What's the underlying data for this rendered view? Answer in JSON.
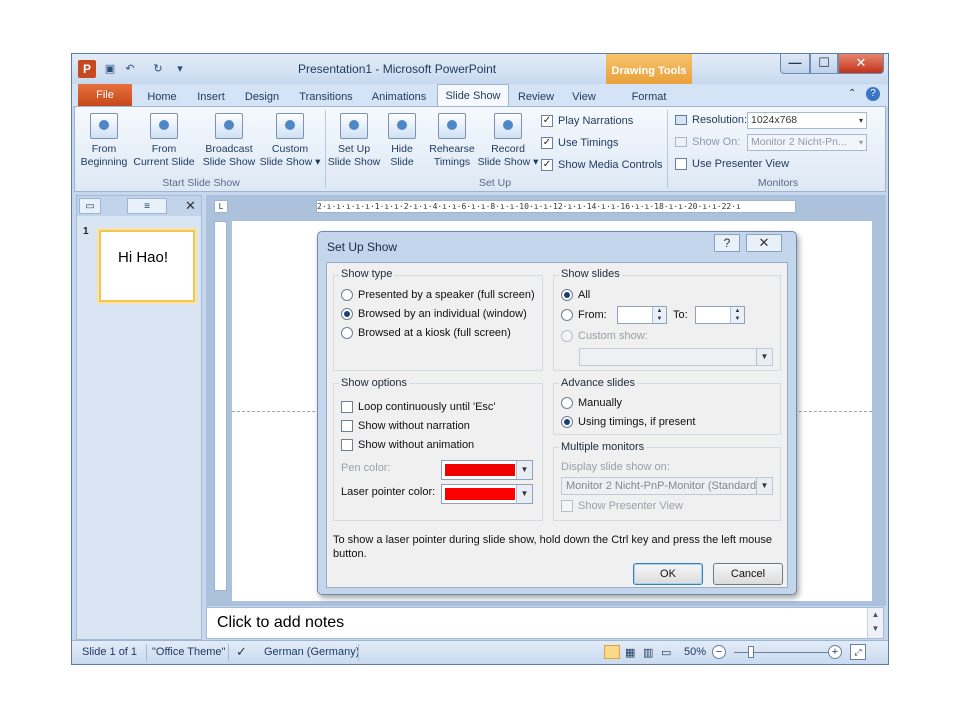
{
  "titlebar": {
    "title": "Presentation1 - Microsoft PowerPoint",
    "contextual_tab": "Drawing Tools",
    "app_icon": "P",
    "qat": [
      "save-icon",
      "undo-icon",
      "redo-icon",
      "customize-icon"
    ],
    "controls": {
      "minimize": "—",
      "maximize": "☐",
      "close": "✕"
    }
  },
  "tabs": [
    "File",
    "Home",
    "Insert",
    "Design",
    "Transitions",
    "Animations",
    "Slide Show",
    "Review",
    "View",
    "Format"
  ],
  "active_tab": "Slide Show",
  "ribbon": {
    "start_group": {
      "label": "Start Slide Show",
      "buttons": [
        {
          "line1": "From",
          "line2": "Beginning"
        },
        {
          "line1": "From",
          "line2": "Current Slide"
        },
        {
          "line1": "Broadcast",
          "line2": "Slide Show"
        },
        {
          "line1": "Custom",
          "line2": "Slide Show ▾"
        }
      ]
    },
    "setup_group": {
      "label": "Set Up",
      "buttons": [
        {
          "line1": "Set Up",
          "line2": "Slide Show"
        },
        {
          "line1": "Hide",
          "line2": "Slide"
        },
        {
          "line1": "Rehearse",
          "line2": "Timings"
        },
        {
          "line1": "Record",
          "line2": "Slide Show ▾"
        }
      ],
      "checks": [
        {
          "label": "Play Narrations",
          "checked": true
        },
        {
          "label": "Use Timings",
          "checked": true
        },
        {
          "label": "Show Media Controls",
          "checked": true
        }
      ]
    },
    "monitors_group": {
      "label": "Monitors",
      "resolution_label": "Resolution:",
      "resolution_value": "1024x768",
      "show_on_label": "Show On:",
      "show_on_value": "Monitor 2 Nicht-Pn...",
      "presenter_view_label": "Use Presenter View",
      "presenter_view_checked": false
    }
  },
  "slides_pane": {
    "slide_number": "1",
    "thumbnail_text": "Hi Hao!"
  },
  "ruler": {
    "horizontal": "2·ı·ı·ı·ı·ı·1·ı·ı·2·ı·ı·4·ı·ı·6·ı·ı·8·ı·ı·10·ı·ı·12·ı·ı·14·ı·ı·16·ı·ı·18·ı·ı·20·ı·ı·22·ı"
  },
  "notes": {
    "placeholder": "Click to add notes"
  },
  "statusbar": {
    "slide_info": "Slide 1 of 1",
    "theme": "\"Office Theme\"",
    "language": "German (Germany)",
    "zoom": "50%"
  },
  "dialog": {
    "title": "Set Up Show",
    "show_type": {
      "legend": "Show type",
      "options": [
        {
          "label": "Presented by a speaker (full screen)",
          "selected": false
        },
        {
          "label": "Browsed by an individual (window)",
          "selected": true
        },
        {
          "label": "Browsed at a kiosk (full screen)",
          "selected": false
        }
      ]
    },
    "show_slides": {
      "legend": "Show slides",
      "all_label": "All",
      "from_label": "From:",
      "to_label": "To:",
      "from_value": "",
      "to_value": "",
      "custom_label": "Custom show:",
      "selected": "All"
    },
    "show_options": {
      "legend": "Show options",
      "checks": [
        {
          "label": "Loop continuously until 'Esc'",
          "checked": false
        },
        {
          "label": "Show without narration",
          "checked": false
        },
        {
          "label": "Show without animation",
          "checked": false
        }
      ],
      "pen_color_label": "Pen color:",
      "laser_color_label": "Laser pointer color:",
      "pen_color": "#ff0000",
      "laser_color": "#ff0000"
    },
    "advance_slides": {
      "legend": "Advance slides",
      "options": [
        {
          "label": "Manually",
          "selected": false
        },
        {
          "label": "Using timings, if present",
          "selected": true
        }
      ]
    },
    "multiple_monitors": {
      "legend": "Multiple monitors",
      "display_label": "Display slide show on:",
      "display_value": "Monitor 2 Nicht-PnP-Monitor (Standard)",
      "presenter_view_label": "Show Presenter View"
    },
    "hint": "To show a laser pointer during slide show, hold down the Ctrl key and press the left mouse button.",
    "ok_label": "OK",
    "cancel_label": "Cancel"
  }
}
